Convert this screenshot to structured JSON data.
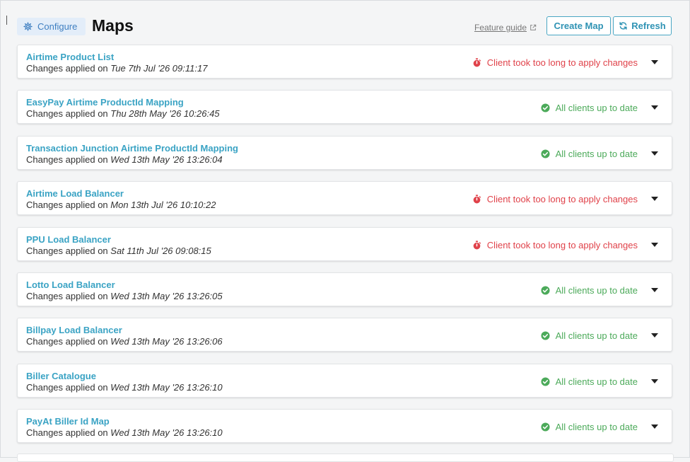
{
  "header": {
    "configure_label": "Configure",
    "title": "Maps",
    "feature_guide_label": "Feature guide",
    "create_map_label": "Create Map",
    "refresh_label": "Refresh"
  },
  "changes_prefix": "Changes applied on",
  "colors": {
    "accent": "#3aa3c4",
    "ok": "#4caa5a",
    "error": "#e0424a"
  },
  "maps": [
    {
      "name": "Airtime Product List",
      "date": "Tue 7th Jul '26 09:11:17",
      "status": "Client took too long to apply changes",
      "state": "error"
    },
    {
      "name": "EasyPay Airtime ProductId Mapping",
      "date": "Thu 28th May '26 10:26:45",
      "status": "All clients up to date",
      "state": "ok"
    },
    {
      "name": "Transaction Junction Airtime ProductId Mapping",
      "date": "Wed 13th May '26 13:26:04",
      "status": "All clients up to date",
      "state": "ok"
    },
    {
      "name": "Airtime Load Balancer",
      "date": "Mon 13th Jul '26 10:10:22",
      "status": "Client took too long to apply changes",
      "state": "error"
    },
    {
      "name": "PPU Load Balancer",
      "date": "Sat 11th Jul '26 09:08:15",
      "status": "Client took too long to apply changes",
      "state": "error"
    },
    {
      "name": "Lotto Load Balancer",
      "date": "Wed 13th May '26 13:26:05",
      "status": "All clients up to date",
      "state": "ok"
    },
    {
      "name": "Billpay Load Balancer",
      "date": "Wed 13th May '26 13:26:06",
      "status": "All clients up to date",
      "state": "ok"
    },
    {
      "name": "Biller Catalogue",
      "date": "Wed 13th May '26 13:26:10",
      "status": "All clients up to date",
      "state": "ok"
    },
    {
      "name": "PayAt Biller Id Map",
      "date": "Wed 13th May '26 13:26:10",
      "status": "All clients up to date",
      "state": "ok"
    }
  ]
}
